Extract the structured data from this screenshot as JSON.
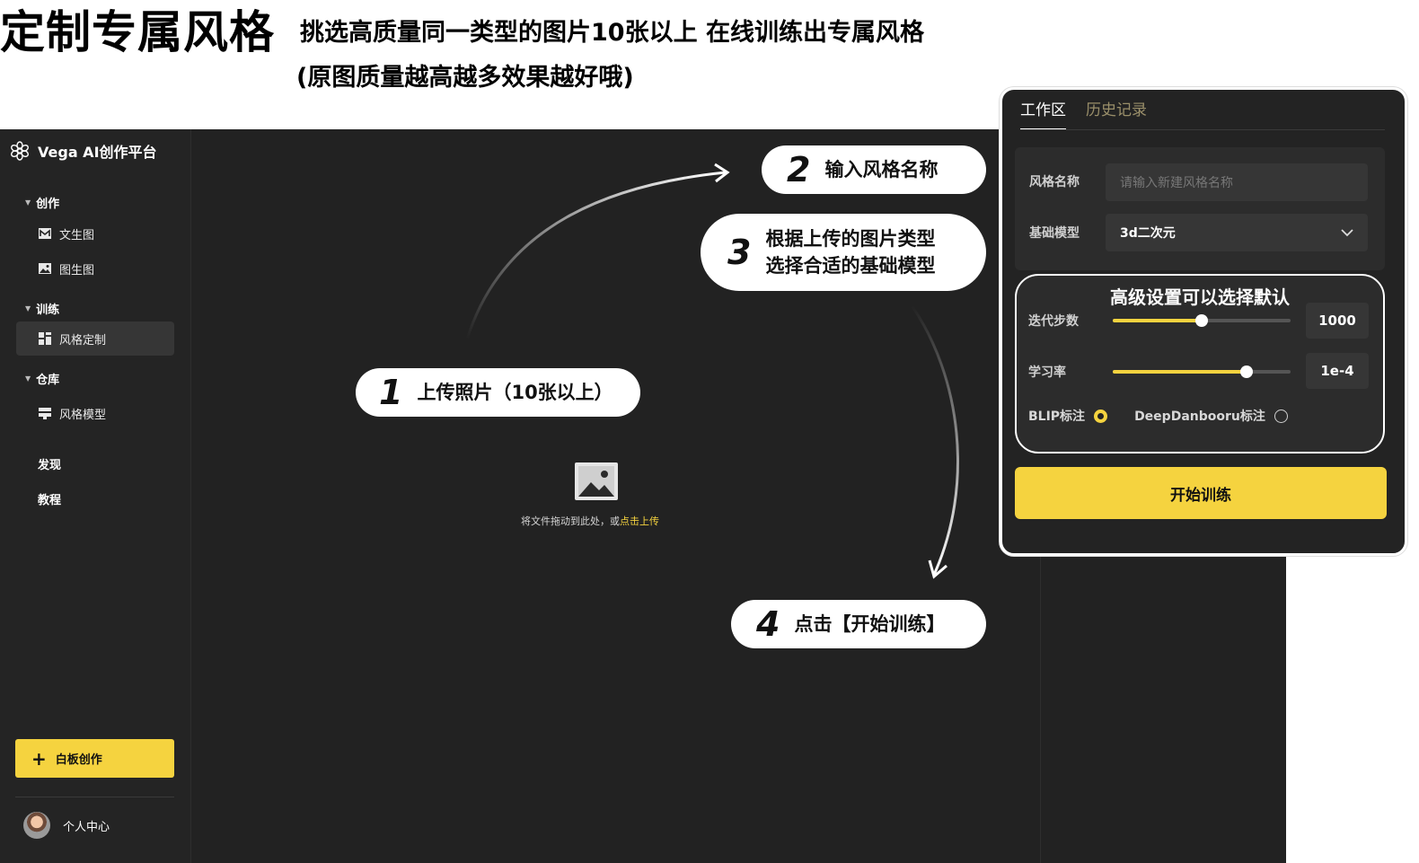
{
  "header": {
    "title": "定制专属风格",
    "subtitle_line1": "挑选高质量同一类型的图片10张以上 在线训练出专属风格",
    "subtitle_line2": "(原图质量越高越多效果越好哦)"
  },
  "sidebar": {
    "brand": "Vega AI创作平台",
    "sections": [
      {
        "label": "创作",
        "items": [
          {
            "label": "文生图",
            "icon": "text-to-image-icon"
          },
          {
            "label": "图生图",
            "icon": "image-to-image-icon"
          }
        ]
      },
      {
        "label": "训练",
        "items": [
          {
            "label": "风格定制",
            "icon": "style-custom-icon",
            "active": true
          }
        ]
      },
      {
        "label": "仓库",
        "items": [
          {
            "label": "风格模型",
            "icon": "style-model-icon"
          }
        ]
      }
    ],
    "discover": "发现",
    "tutorial": "教程",
    "board_button": "白板创作",
    "user": "个人中心"
  },
  "upload": {
    "hint": "将文件拖动到此处，或",
    "link": "点击上传"
  },
  "callouts": {
    "step1": {
      "num": "1",
      "text": "上传照片（10张以上）"
    },
    "step2": {
      "num": "2",
      "text": "输入风格名称"
    },
    "step3": {
      "num": "3",
      "line1": "根据上传的图片类型",
      "line2": "选择合适的基础模型"
    },
    "step4": {
      "num": "4",
      "text": "点击【开始训练】"
    }
  },
  "panel": {
    "tabs": [
      "工作区",
      "历史记录"
    ],
    "style_name_label": "风格名称",
    "style_name_placeholder": "请输入新建风格名称",
    "base_model_label": "基础模型",
    "base_model_value": "3d二次元",
    "advanced_note": "高级设置可以选择默认",
    "steps_label": "迭代步数",
    "steps_value": "1000",
    "steps_level": 0.5,
    "lr_label": "学习率",
    "lr_value": "1e-4",
    "lr_level": 0.75,
    "blip_label": "BLIP标注",
    "deepdanbooru_label": "DeepDanbooru标注",
    "start_button": "开始训练"
  },
  "colors": {
    "accent": "#f5d33f",
    "background": "#222222",
    "sidebar": "#242424"
  }
}
